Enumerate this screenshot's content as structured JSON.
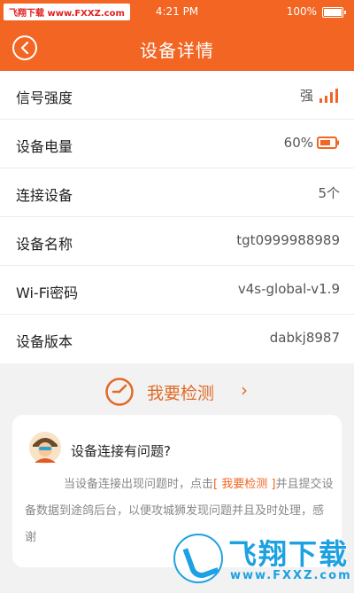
{
  "status_bar": {
    "time": "4:21 PM",
    "battery": "100%"
  },
  "watermark_tag": "飞翔下载 www.FXXZ.com",
  "navbar": {
    "title": "设备详情"
  },
  "details": [
    {
      "label": "信号强度",
      "value": "强",
      "icon": "signal-bars-icon"
    },
    {
      "label": "设备电量",
      "value": "60%",
      "icon": "battery-icon"
    },
    {
      "label": "连接设备",
      "value": "5个"
    },
    {
      "label": "设备名称",
      "value": "tgt0999988989"
    },
    {
      "label": "Wi-Fi密码",
      "value": "v4s-global-v1.9"
    },
    {
      "label": "设备版本",
      "value": "dabkj8987"
    }
  ],
  "check": {
    "label": "我要检测",
    "chevron": "›"
  },
  "help_card": {
    "title": "设备连接有问题?",
    "text_before": "当设备连接出现问题时，点击",
    "highlight": "[ 我要检测 ]",
    "text_after": "并且提交设备数据到途鸽后台，以便攻城狮发现问题并且及时处理，感谢"
  },
  "brand_watermark": {
    "name": "飞翔下载",
    "url": "www.FXXZ.com"
  },
  "colors": {
    "accent": "#f26522"
  }
}
